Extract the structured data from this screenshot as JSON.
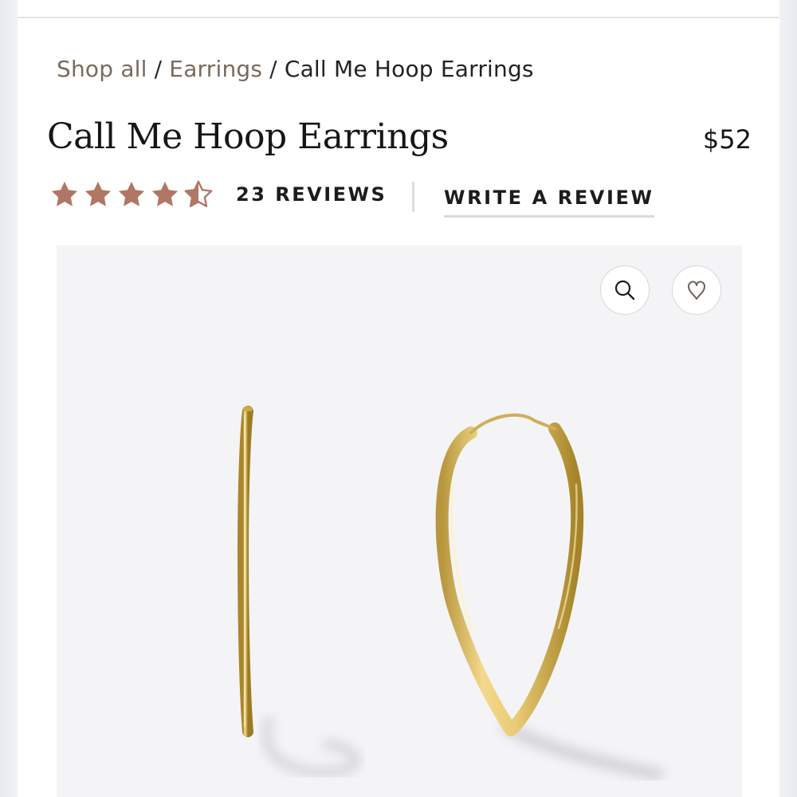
{
  "breadcrumb": {
    "items": [
      {
        "label": "Shop all",
        "link": true
      },
      {
        "label": "Earrings",
        "link": true
      },
      {
        "label": "Call Me Hoop Earrings",
        "link": false
      }
    ],
    "separator": "/"
  },
  "product": {
    "title": "Call Me Hoop Earrings",
    "price": "$52",
    "rating": 4.5,
    "rating_max": 5,
    "reviews_label": "23 REVIEWS",
    "write_review_label": "WRITE A REVIEW"
  },
  "image": {
    "icons": [
      "search-icon",
      "heart-icon"
    ]
  },
  "colors": {
    "star": "#b07764",
    "link": "#7a6a5d",
    "gold": "#d6b45a"
  }
}
